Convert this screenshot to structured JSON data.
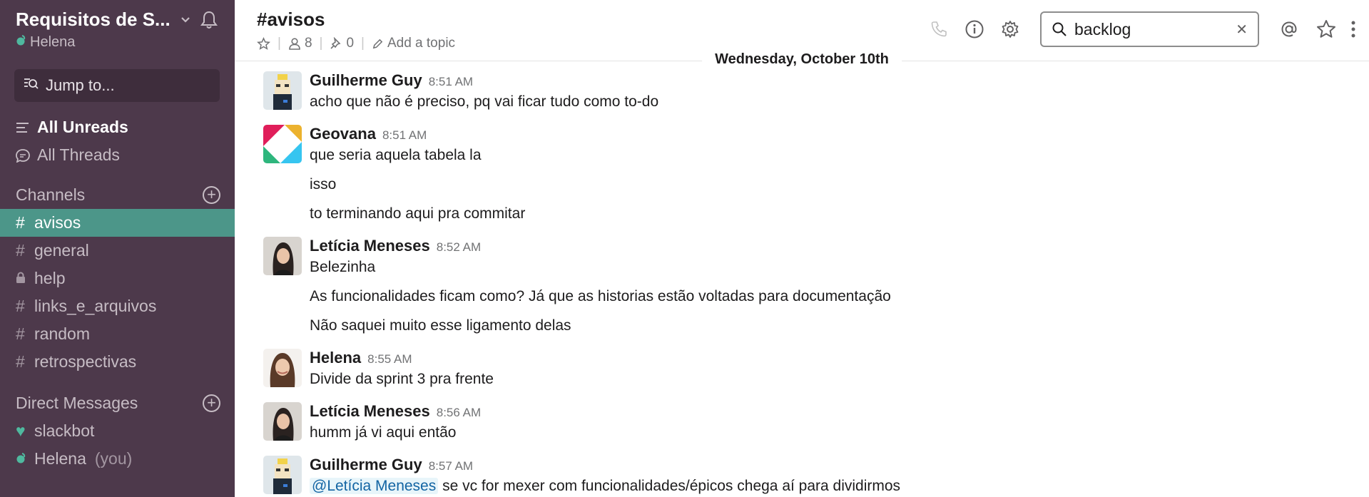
{
  "sidebar": {
    "team_name": "Requisitos de S...",
    "user_name": "Helena",
    "jump_label": "Jump to...",
    "all_unreads": "All Unreads",
    "all_threads": "All Threads",
    "channels_heading": "Channels",
    "channels": [
      {
        "name": "avisos",
        "prefix": "#"
      },
      {
        "name": "general",
        "prefix": "#"
      },
      {
        "name": "help",
        "prefix": "lock"
      },
      {
        "name": "links_e_arquivos",
        "prefix": "#"
      },
      {
        "name": "random",
        "prefix": "#"
      },
      {
        "name": "retrospectivas",
        "prefix": "#"
      }
    ],
    "dm_heading": "Direct Messages",
    "dms": [
      {
        "name": "slackbot",
        "suffix": ""
      },
      {
        "name": "Helena",
        "suffix": "(you)"
      }
    ]
  },
  "header": {
    "channel_title": "#avisos",
    "members_count": "8",
    "pins_count": "0",
    "add_topic": "Add a topic",
    "search_value": "backlog"
  },
  "date_divider": "Wednesday, October 10th",
  "messages": [
    {
      "author": "Guilherme Guy",
      "time": "8:51 AM",
      "avatar": "pixel",
      "lines": [
        "acho que não é preciso, pq vai ficar tudo como to-do"
      ]
    },
    {
      "author": "Geovana",
      "time": "8:51 AM",
      "avatar": "slack",
      "lines": [
        "que seria aquela tabela la",
        "isso",
        "to terminando aqui pra commitar"
      ]
    },
    {
      "author": "Letícia Meneses",
      "time": "8:52 AM",
      "avatar": "photo",
      "lines": [
        "Belezinha",
        "As funcionalidades ficam como? Já que as historias estão voltadas para documentação",
        "Não saquei muito esse ligamento delas"
      ]
    },
    {
      "author": "Helena",
      "time": "8:55 AM",
      "avatar": "photo2",
      "lines": [
        "Divide da sprint 3 pra frente"
      ]
    },
    {
      "author": "Letícia Meneses",
      "time": "8:56 AM",
      "avatar": "photo",
      "lines": [
        "humm já vi aqui então"
      ]
    },
    {
      "author": "Guilherme Guy",
      "time": "8:57 AM",
      "avatar": "pixel",
      "mention": "@Letícia Meneses",
      "lines": [
        "se vc for mexer com funcionalidades/épicos chega aí para dividirmos"
      ]
    }
  ]
}
